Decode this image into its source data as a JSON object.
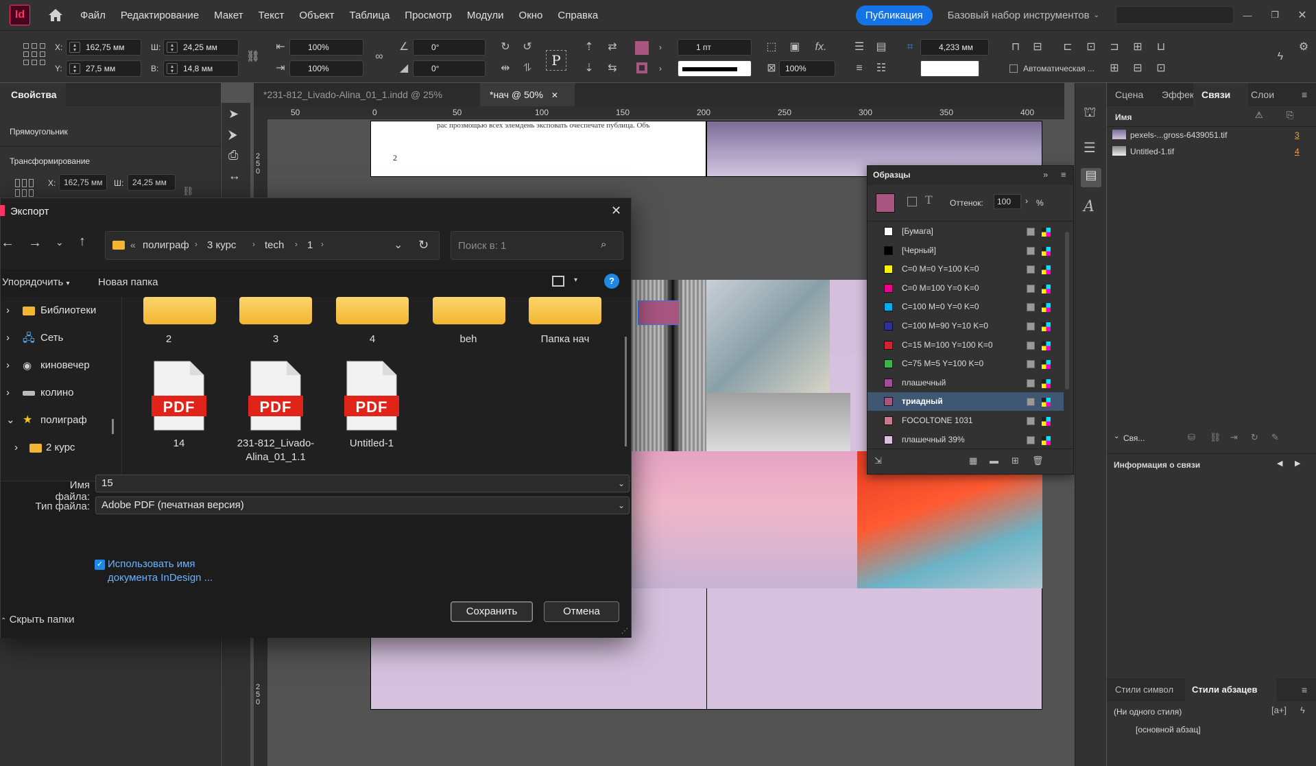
{
  "app": {
    "logo": "Id",
    "menu": [
      "Файл",
      "Редактирование",
      "Макет",
      "Текст",
      "Объект",
      "Таблица",
      "Просмотр",
      "Модули",
      "Окно",
      "Справка"
    ],
    "publish": "Публикация",
    "workspace": "Базовый набор инструментов"
  },
  "control": {
    "x_label": "X:",
    "x": "162,75 мм",
    "y_label": "Y:",
    "y": "27,5 мм",
    "w_label": "Ш:",
    "w": "24,25 мм",
    "h_label": "В:",
    "h": "14,8 мм",
    "scale_x": "100%",
    "scale_y": "100%",
    "angle": "0°",
    "shear": "0°",
    "stroke_weight": "1 пт",
    "opacity": "100%",
    "spacing": "4,233 мм",
    "auto_label": "Автоматическая ..."
  },
  "left_panel": {
    "tab": "Свойства",
    "object": "Прямоугольник",
    "section": "Трансформирование",
    "x_label": "X:",
    "x": "162,75 мм",
    "w_label": "Ш:",
    "w": "24,25 мм"
  },
  "doc_tabs": [
    "*231-812_Livado-Alina_01_1.indd @ 25%",
    "*нач @ 50%"
  ],
  "ruler": [
    "50",
    "0",
    "50",
    "100",
    "150",
    "200",
    "250",
    "300",
    "350",
    "400"
  ],
  "vruler": [
    "2 5 0",
    "2 5 0"
  ],
  "page_text": {
    "line": "рас прозмощью всех элемдень эксповать очеспечате публица. Объ",
    "page_num": "2"
  },
  "dialog": {
    "title": "Экспорт",
    "path": [
      "полиграф",
      "3 курс",
      "tech",
      "1"
    ],
    "search_placeholder": "Поиск в: 1",
    "organize": "Упорядочить",
    "new_folder": "Новая папка",
    "tree": [
      "Библиотеки",
      "Сеть",
      "киновечер",
      "колино",
      "полиграф",
      "2 курс"
    ],
    "folders": [
      "2",
      "3",
      "4",
      "beh",
      "Папка нач"
    ],
    "files": [
      {
        "badge": "PDF",
        "name": "14"
      },
      {
        "badge": "PDF",
        "name": "231-812_Livado-Alina_01_1.1"
      },
      {
        "badge": "PDF",
        "name": "Untitled-1"
      }
    ],
    "filename_label": "Имя файла:",
    "filename": "15",
    "filetype_label": "Тип файла:",
    "filetype": "Adobe PDF (печатная версия)",
    "checkbox_label": "Использовать имя документа InDesign ...",
    "hide_folders": "Скрыть папки",
    "save": "Сохранить",
    "cancel": "Отмена"
  },
  "swatches": {
    "title": "Образцы",
    "tint_label": "Оттенок:",
    "tint": "100",
    "percent": "%",
    "items": [
      {
        "name": "[Бумага]",
        "color": "#ffffff"
      },
      {
        "name": "[Черный]",
        "color": "#000000"
      },
      {
        "name": "C=0 M=0 Y=100 K=0",
        "color": "#fff200"
      },
      {
        "name": "C=0 M=100 Y=0 K=0",
        "color": "#ec008c"
      },
      {
        "name": "C=100 M=0 Y=0 K=0",
        "color": "#00aeef"
      },
      {
        "name": "C=100 M=90 Y=10 K=0",
        "color": "#2e3192"
      },
      {
        "name": "C=15 M=100 Y=100 K=0",
        "color": "#d2232a"
      },
      {
        "name": "C=75 M=5 Y=100 K=0",
        "color": "#39b54a"
      },
      {
        "name": "плашечный",
        "color": "#9c4f96"
      },
      {
        "name": "триадный",
        "color": "#a8557f"
      },
      {
        "name": "FOCOLTONE 1031",
        "color": "#c97a8c"
      },
      {
        "name": "плашечный 39%",
        "color": "#d9c2dd"
      }
    ]
  },
  "right_panel": {
    "tabs": [
      "Сцена",
      "Эффек",
      "Связи",
      "Слои"
    ],
    "name_header": "Имя",
    "links": [
      {
        "name": "pexels-...gross-6439051.tif",
        "page": "3"
      },
      {
        "name": "Untitled-1.tif",
        "page": "4"
      }
    ],
    "links_collapsed": "Свя...",
    "link_info": "Информация о связи",
    "style_tabs": [
      "Стили символ",
      "Стили абзацев"
    ],
    "styles": [
      "(Ни одного стиля)",
      "[основной абзац]"
    ]
  },
  "colors": {
    "accent": "#1473e6",
    "selected_swatch": "#a8557f",
    "page_lilac": "#d6c1de"
  }
}
